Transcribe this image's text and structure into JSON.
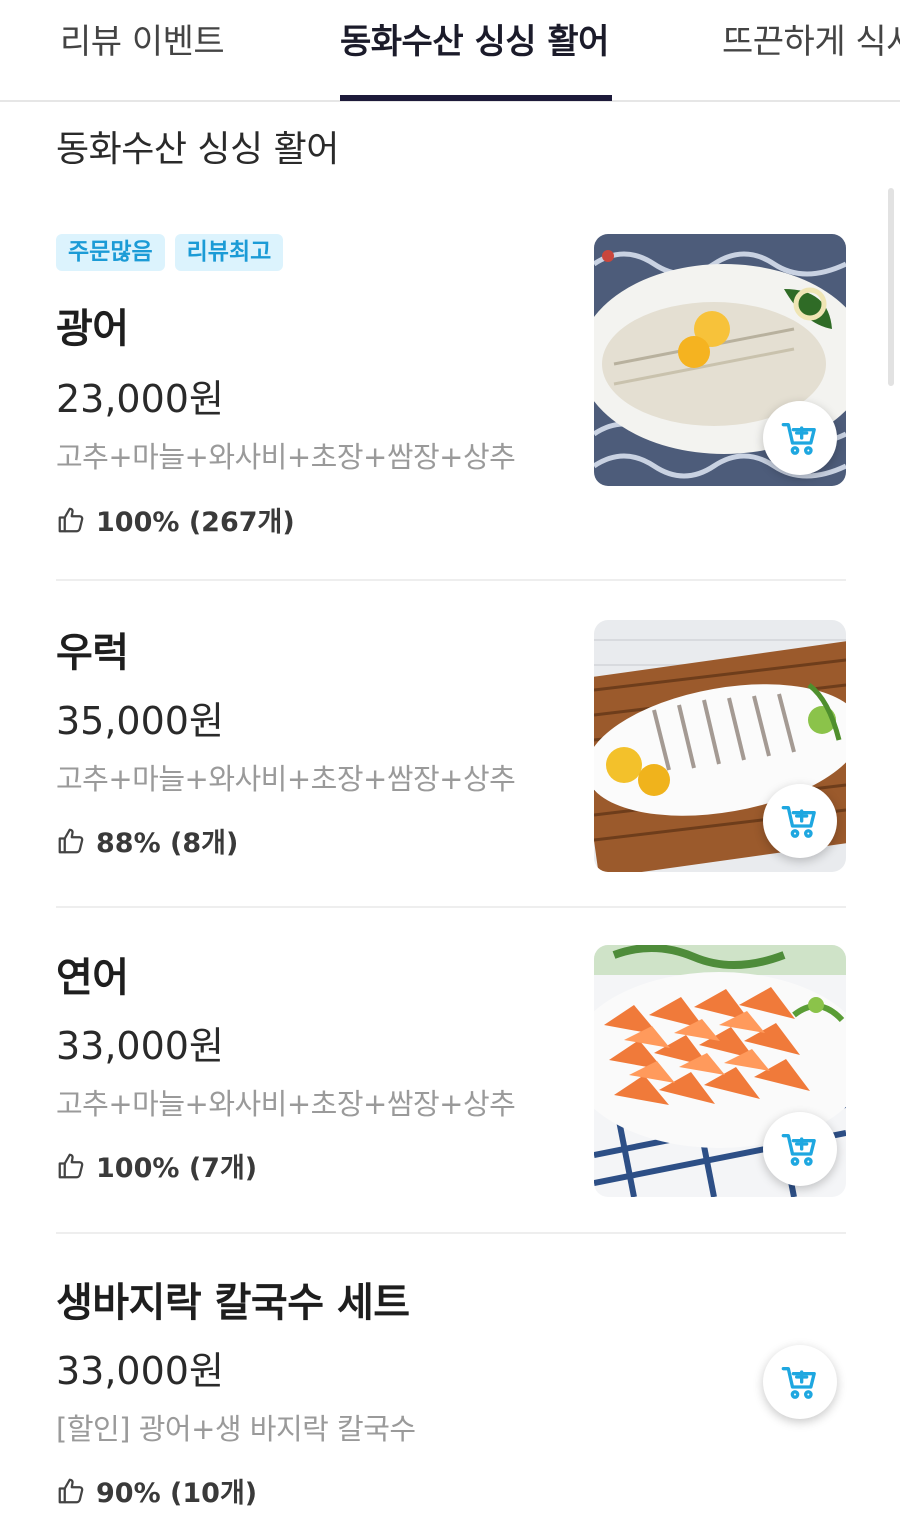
{
  "tabs": [
    {
      "label": "리뷰 이벤트"
    },
    {
      "label": "동화수산 싱싱 활어"
    },
    {
      "label": "뜨끈하게 식사"
    }
  ],
  "section_title": "동화수산 싱싱 활어",
  "menu_items": [
    {
      "badges": [
        "주문많음",
        "리뷰최고"
      ],
      "name": "광어",
      "price": "23,000원",
      "description": "고추+마늘+와사비+초장+쌈장+상추",
      "rating": "100% (267개)"
    },
    {
      "name": "우럭",
      "price": "35,000원",
      "description": "고추+마늘+와사비+초장+쌈장+상추",
      "rating": "88% (8개)"
    },
    {
      "name": "연어",
      "price": "33,000원",
      "description": "고추+마늘+와사비+초장+쌈장+상추",
      "rating": "100% (7개)"
    },
    {
      "name": "생바지락 칼국수 세트",
      "price": "33,000원",
      "description": "[할인] 광어+생 바지락 칼국수",
      "rating": "90% (10개)"
    }
  ],
  "colors": {
    "active_tab_underline": "#1d1a3a",
    "badge_bg": "#dcf3fd",
    "badge_text": "#1b9bd6",
    "cart_icon": "#1ea7e0"
  },
  "icons": {
    "rating": "thumbs-up-icon",
    "cart": "add-to-cart-icon"
  }
}
